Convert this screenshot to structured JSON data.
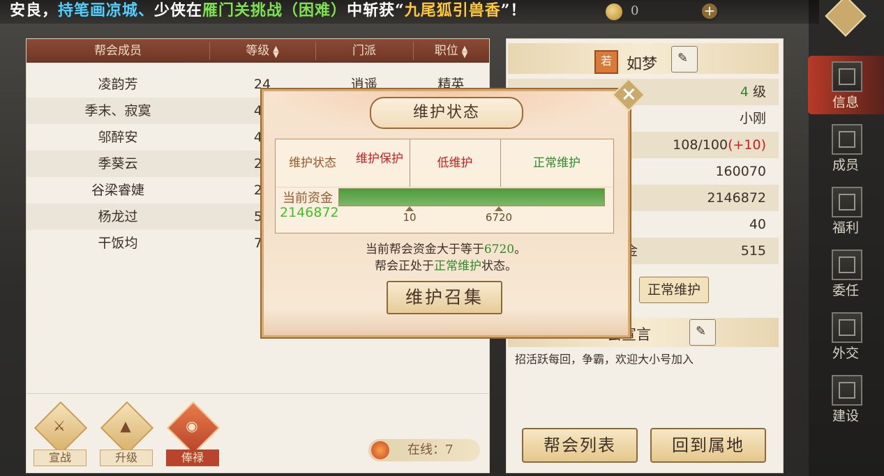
{
  "ticker": {
    "p1": "安良，",
    "p2": "持笔画凉城、",
    "p3": "少侠在",
    "p4": "雁门关挑战（困难）",
    "p5": "中斩获“",
    "p6": "九尾狐引兽香",
    "p7": "”！"
  },
  "currency": {
    "value2": "0"
  },
  "members": {
    "headers": {
      "name": "帮会成员",
      "level": "等级",
      "sect": "门派",
      "position": "职位"
    },
    "rows": [
      {
        "name": "凌韵芳",
        "level": "24",
        "sect": "逍遥",
        "position": "精英"
      },
      {
        "name": "季末、寂寞",
        "level": "40",
        "sect": "",
        "position": ""
      },
      {
        "name": "邬醉安",
        "level": "43",
        "sect": "",
        "position": ""
      },
      {
        "name": "季葵云",
        "level": "26",
        "sect": "",
        "position": ""
      },
      {
        "name": "谷梁睿婕",
        "level": "25",
        "sect": "",
        "position": ""
      },
      {
        "name": "杨龙过",
        "level": "59",
        "sect": "",
        "position": ""
      },
      {
        "name": "干饭均",
        "level": "79",
        "sect": "",
        "position": ""
      }
    ]
  },
  "actions": {
    "declare_war": "宣战",
    "upgrade": "升级",
    "salary": "俸禄"
  },
  "online": {
    "label": "在线：7"
  },
  "guild": {
    "badge": "若",
    "name": "如梦",
    "level_value": "4",
    "level_unit": " 级",
    "leader": "小刚",
    "members_value": "108/100",
    "members_bonus": "(+10)",
    "stat4": "160070",
    "funds": "2146872",
    "stat6": "40",
    "stat7_label": "资金",
    "stat7_value": "515",
    "maint_chip": "正常维护",
    "declaration_title": "会宣言",
    "declaration_text": "招活跃每回，争霸，欢迎大小号加入",
    "list_button": "帮会列表",
    "home_button": "回到属地"
  },
  "nav": {
    "info": "信息",
    "members": "成员",
    "welfare": "福利",
    "appoint": "委任",
    "diplomacy": "外交",
    "build": "建设"
  },
  "modal": {
    "title": "维护状态",
    "status_label": "维护状态",
    "protect": "维护保护",
    "low": "低维护",
    "normal": "正常维护",
    "fund_label": "当前资金",
    "fund_value": "2146872",
    "tick_low": "10",
    "tick_normal": "6720",
    "fill_fraction": 1.0,
    "msg1_a": "当前帮会资金大于等于",
    "msg1_b": "6720",
    "msg1_c": "。",
    "msg2_a": "帮会正处于",
    "msg2_b": "正常维护",
    "msg2_c": "状态。",
    "button": "维护召集"
  },
  "colors": {
    "accent_red": "#c82020",
    "accent_green": "#2e8a2a",
    "fund_green": "#3ec22a",
    "header_brown": "#8a4a34"
  }
}
